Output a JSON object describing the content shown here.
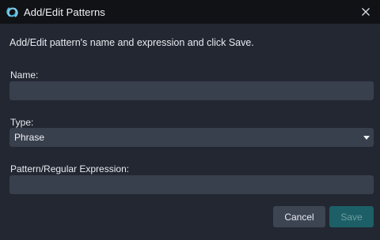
{
  "window": {
    "title": "Add/Edit Patterns",
    "close_label": "close"
  },
  "instructions": "Add/Edit pattern's name and expression and click Save.",
  "form": {
    "name_label": "Name:",
    "name_value": "",
    "type_label": "Type:",
    "type_selected": "Phrase",
    "pattern_label": "Pattern/Regular Expression:",
    "pattern_value": ""
  },
  "buttons": {
    "cancel_label": "Cancel",
    "save_label": "Save",
    "save_enabled": false
  },
  "colors": {
    "titlebar_bg": "#101216",
    "window_bg": "#222731",
    "input_bg": "#39404d",
    "cancel_bg": "#3d4553",
    "save_bg": "#1d5f66",
    "save_text_disabled": "#6f9ea2",
    "app_icon_accent": "#3fb8e0"
  },
  "icons": {
    "app": "app-logo-icon",
    "close": "close-icon",
    "dropdown": "chevron-down-icon"
  }
}
